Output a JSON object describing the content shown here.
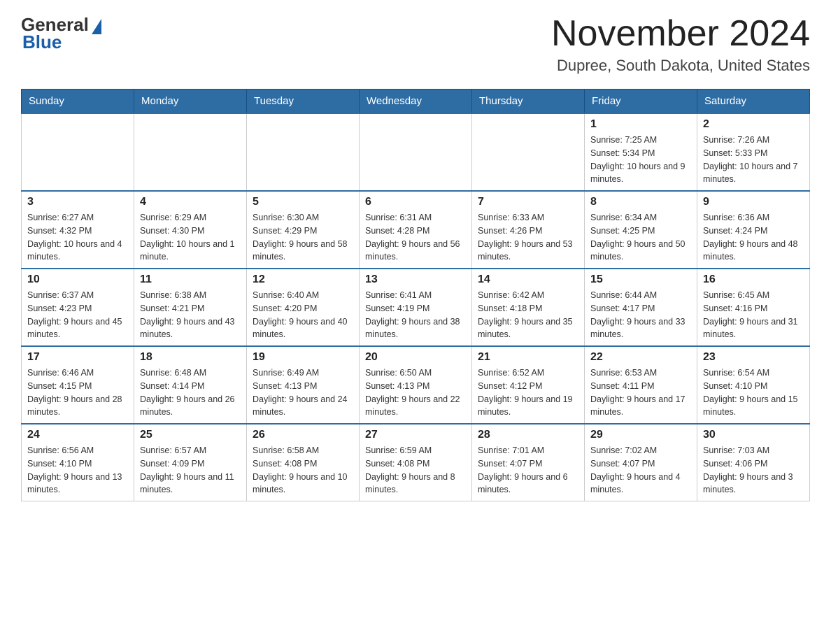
{
  "logo": {
    "general": "General",
    "blue": "Blue"
  },
  "title": "November 2024",
  "subtitle": "Dupree, South Dakota, United States",
  "headers": [
    "Sunday",
    "Monday",
    "Tuesday",
    "Wednesday",
    "Thursday",
    "Friday",
    "Saturday"
  ],
  "weeks": [
    [
      {
        "day": "",
        "info": ""
      },
      {
        "day": "",
        "info": ""
      },
      {
        "day": "",
        "info": ""
      },
      {
        "day": "",
        "info": ""
      },
      {
        "day": "",
        "info": ""
      },
      {
        "day": "1",
        "info": "Sunrise: 7:25 AM\nSunset: 5:34 PM\nDaylight: 10 hours and 9 minutes."
      },
      {
        "day": "2",
        "info": "Sunrise: 7:26 AM\nSunset: 5:33 PM\nDaylight: 10 hours and 7 minutes."
      }
    ],
    [
      {
        "day": "3",
        "info": "Sunrise: 6:27 AM\nSunset: 4:32 PM\nDaylight: 10 hours and 4 minutes."
      },
      {
        "day": "4",
        "info": "Sunrise: 6:29 AM\nSunset: 4:30 PM\nDaylight: 10 hours and 1 minute."
      },
      {
        "day": "5",
        "info": "Sunrise: 6:30 AM\nSunset: 4:29 PM\nDaylight: 9 hours and 58 minutes."
      },
      {
        "day": "6",
        "info": "Sunrise: 6:31 AM\nSunset: 4:28 PM\nDaylight: 9 hours and 56 minutes."
      },
      {
        "day": "7",
        "info": "Sunrise: 6:33 AM\nSunset: 4:26 PM\nDaylight: 9 hours and 53 minutes."
      },
      {
        "day": "8",
        "info": "Sunrise: 6:34 AM\nSunset: 4:25 PM\nDaylight: 9 hours and 50 minutes."
      },
      {
        "day": "9",
        "info": "Sunrise: 6:36 AM\nSunset: 4:24 PM\nDaylight: 9 hours and 48 minutes."
      }
    ],
    [
      {
        "day": "10",
        "info": "Sunrise: 6:37 AM\nSunset: 4:23 PM\nDaylight: 9 hours and 45 minutes."
      },
      {
        "day": "11",
        "info": "Sunrise: 6:38 AM\nSunset: 4:21 PM\nDaylight: 9 hours and 43 minutes."
      },
      {
        "day": "12",
        "info": "Sunrise: 6:40 AM\nSunset: 4:20 PM\nDaylight: 9 hours and 40 minutes."
      },
      {
        "day": "13",
        "info": "Sunrise: 6:41 AM\nSunset: 4:19 PM\nDaylight: 9 hours and 38 minutes."
      },
      {
        "day": "14",
        "info": "Sunrise: 6:42 AM\nSunset: 4:18 PM\nDaylight: 9 hours and 35 minutes."
      },
      {
        "day": "15",
        "info": "Sunrise: 6:44 AM\nSunset: 4:17 PM\nDaylight: 9 hours and 33 minutes."
      },
      {
        "day": "16",
        "info": "Sunrise: 6:45 AM\nSunset: 4:16 PM\nDaylight: 9 hours and 31 minutes."
      }
    ],
    [
      {
        "day": "17",
        "info": "Sunrise: 6:46 AM\nSunset: 4:15 PM\nDaylight: 9 hours and 28 minutes."
      },
      {
        "day": "18",
        "info": "Sunrise: 6:48 AM\nSunset: 4:14 PM\nDaylight: 9 hours and 26 minutes."
      },
      {
        "day": "19",
        "info": "Sunrise: 6:49 AM\nSunset: 4:13 PM\nDaylight: 9 hours and 24 minutes."
      },
      {
        "day": "20",
        "info": "Sunrise: 6:50 AM\nSunset: 4:13 PM\nDaylight: 9 hours and 22 minutes."
      },
      {
        "day": "21",
        "info": "Sunrise: 6:52 AM\nSunset: 4:12 PM\nDaylight: 9 hours and 19 minutes."
      },
      {
        "day": "22",
        "info": "Sunrise: 6:53 AM\nSunset: 4:11 PM\nDaylight: 9 hours and 17 minutes."
      },
      {
        "day": "23",
        "info": "Sunrise: 6:54 AM\nSunset: 4:10 PM\nDaylight: 9 hours and 15 minutes."
      }
    ],
    [
      {
        "day": "24",
        "info": "Sunrise: 6:56 AM\nSunset: 4:10 PM\nDaylight: 9 hours and 13 minutes."
      },
      {
        "day": "25",
        "info": "Sunrise: 6:57 AM\nSunset: 4:09 PM\nDaylight: 9 hours and 11 minutes."
      },
      {
        "day": "26",
        "info": "Sunrise: 6:58 AM\nSunset: 4:08 PM\nDaylight: 9 hours and 10 minutes."
      },
      {
        "day": "27",
        "info": "Sunrise: 6:59 AM\nSunset: 4:08 PM\nDaylight: 9 hours and 8 minutes."
      },
      {
        "day": "28",
        "info": "Sunrise: 7:01 AM\nSunset: 4:07 PM\nDaylight: 9 hours and 6 minutes."
      },
      {
        "day": "29",
        "info": "Sunrise: 7:02 AM\nSunset: 4:07 PM\nDaylight: 9 hours and 4 minutes."
      },
      {
        "day": "30",
        "info": "Sunrise: 7:03 AM\nSunset: 4:06 PM\nDaylight: 9 hours and 3 minutes."
      }
    ]
  ]
}
